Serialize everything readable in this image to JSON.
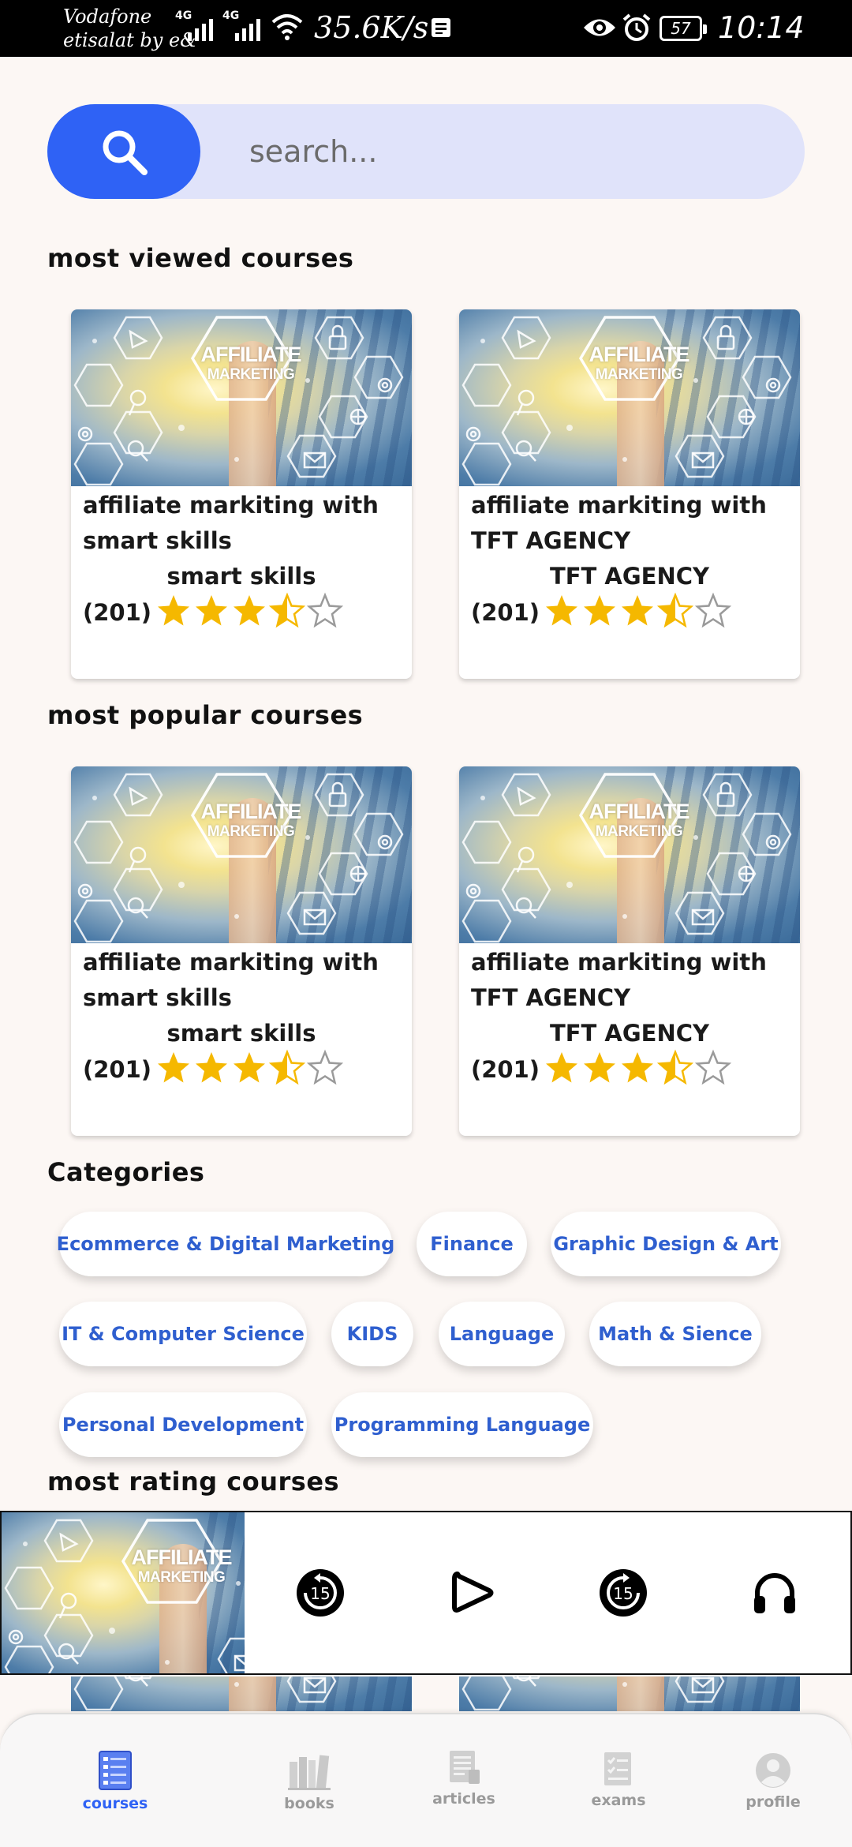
{
  "status_bar": {
    "carrier_line1": "Vodafone",
    "carrier_line2": "etisalat by e&",
    "network1": "4G",
    "network2": "4G",
    "speed": "35.6K/s",
    "battery": "57",
    "time": "10:14"
  },
  "search": {
    "placeholder": "search..."
  },
  "sections": {
    "most_viewed": "most viewed courses",
    "most_popular": "most popular courses",
    "categories": "Categories",
    "most_rating": "most rating courses"
  },
  "thumbnail_text": {
    "line1": "AFFILIATE",
    "line2": "MARKETING"
  },
  "most_viewed": [
    {
      "title": "affiliate markiting with smart skills",
      "author": "smart skills",
      "count": "(201)",
      "rating": 3.5
    },
    {
      "title": "affiliate markiting with TFT AGENCY",
      "author": "TFT AGENCY",
      "count": "(201)",
      "rating": 3.5
    }
  ],
  "most_popular": [
    {
      "title": "affiliate markiting with smart skills",
      "author": "smart skills",
      "count": "(201)",
      "rating": 3.5
    },
    {
      "title": "affiliate markiting with TFT AGENCY",
      "author": "TFT AGENCY",
      "count": "(201)",
      "rating": 3.5
    }
  ],
  "categories": [
    "Ecommerce & Digital Marketing",
    "Finance",
    "Graphic Design & Art",
    "IT & Computer Science",
    "KIDS",
    "Language",
    "Math & Sience",
    "Personal Development",
    "Programming Language"
  ],
  "player": {
    "rewind_seconds": "15",
    "forward_seconds": "15"
  },
  "bottom_nav": {
    "courses": "courses",
    "books": "books",
    "articles": "articles",
    "exams": "exams",
    "profile": "profile",
    "active": "courses"
  },
  "colors": {
    "accent": "#2f62f5",
    "search_bg": "#e0e3fa",
    "star": "#f5b800",
    "chip_text": "#2f5fcf",
    "page_bg": "#fcf7f4"
  },
  "icons": {
    "search": "search-icon",
    "rewind": "rewind-15-icon",
    "play": "play-icon",
    "forward": "forward-15-icon",
    "headphones": "headphones-icon",
    "courses": "courses-icon",
    "books": "books-icon",
    "articles": "articles-icon",
    "exams": "exams-icon",
    "profile": "profile-icon"
  }
}
